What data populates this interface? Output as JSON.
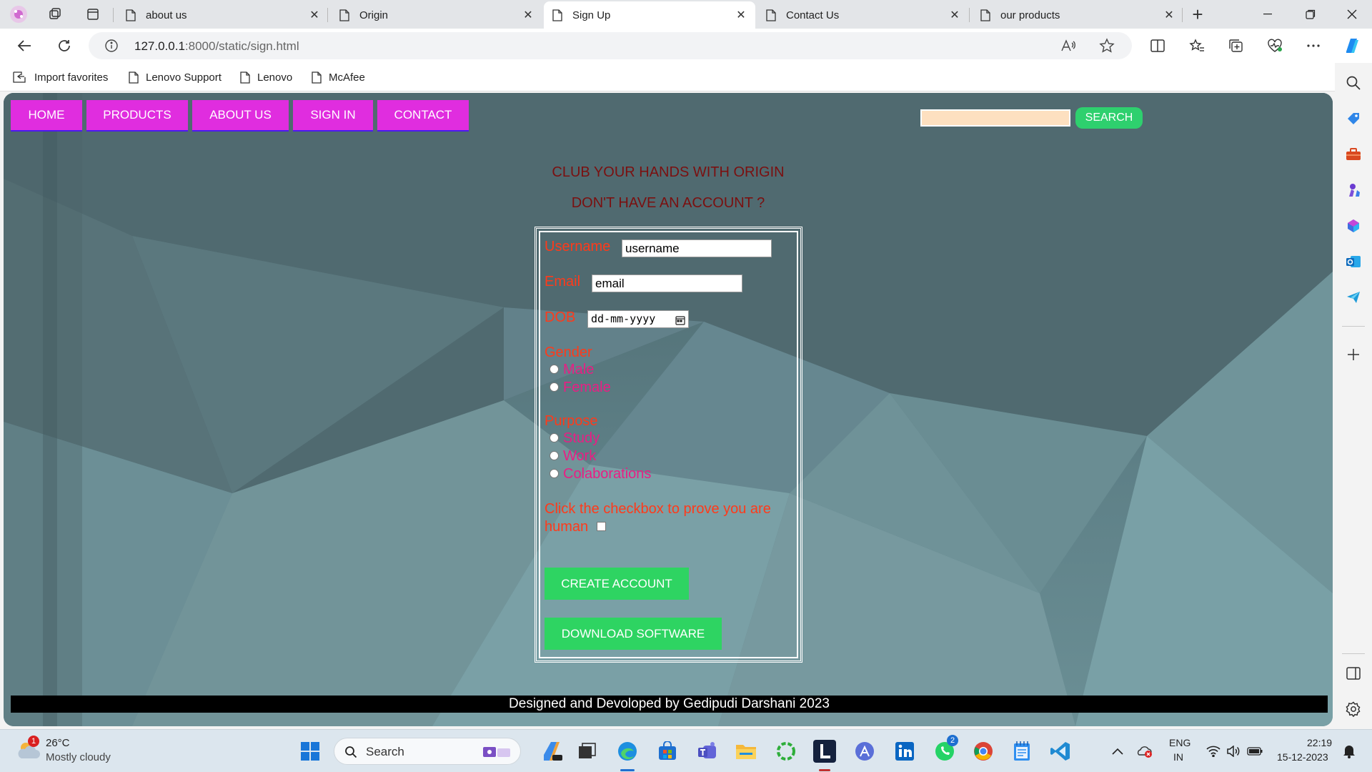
{
  "browser": {
    "tabs": [
      {
        "title": "about us",
        "active": false
      },
      {
        "title": "Origin",
        "active": false
      },
      {
        "title": "Sign Up",
        "active": true
      },
      {
        "title": "Contact Us",
        "active": false
      },
      {
        "title": "our products",
        "active": false
      }
    ],
    "tab_close_glyph": "✕",
    "new_tab_glyph": "+",
    "url_host": "127.0.0.1",
    "url_path": ":8000/static/sign.html",
    "favorites": [
      "Import favorites",
      "Lenovo Support",
      "Lenovo",
      "McAfee"
    ]
  },
  "site": {
    "nav": [
      "HOME",
      "PRODUCTS",
      "ABOUT US",
      "SIGN IN",
      "CONTACT"
    ],
    "search_button": "SEARCH",
    "search_value": "",
    "headline": "CLUB YOUR HANDS WITH ORIGIN",
    "subheadline": "DON'T HAVE AN ACCOUNT ?",
    "form": {
      "username_label": "Username",
      "username_value": "username",
      "email_label": "Email",
      "email_value": "email",
      "dob_label": "DOB",
      "dob_placeholder": "dd-mm-yyyy",
      "gender_label": "Gender",
      "gender_options": [
        "Male",
        "Female"
      ],
      "purpose_label": "Purpose",
      "purpose_options": [
        "Study",
        "Work",
        "Colaborations"
      ],
      "human_label": "Click the checkbox to prove you are human",
      "create_button": "CREATE ACCOUNT",
      "download_button": "DOWNLOAD SOFTWARE"
    },
    "footer": "Designed and Devoloped by Gedipudi Darshani 2023"
  },
  "taskbar": {
    "weather_temp": "26°C",
    "weather_desc": "Mostly cloudy",
    "weather_badge": "1",
    "search_placeholder": "Search",
    "teams_badge": "2",
    "lang_line1": "ENG",
    "lang_line2": "IN",
    "time": "22:19",
    "date": "15-12-2023"
  },
  "colors": {
    "nav_magenta": "#e02ddf",
    "button_green": "#2ed462",
    "label_red": "#ff3a1a",
    "option_pink": "#e91e84",
    "heading_maroon": "#7a1010"
  }
}
